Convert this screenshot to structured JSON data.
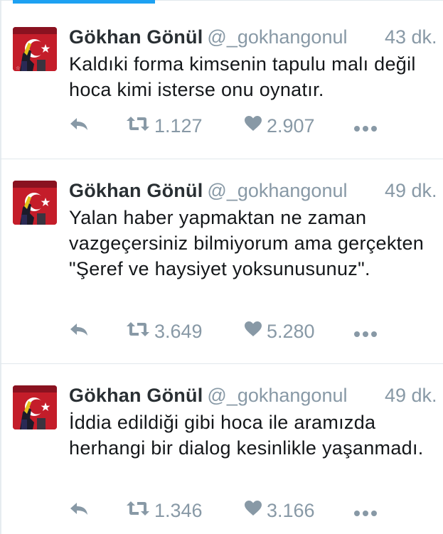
{
  "tweets": [
    {
      "name": "Gökhan Gönül",
      "handle": "@_gokhangonul",
      "time": "43 dk.",
      "text": "Kaldıki forma kimsenin tapulu malı değil hoca kimi isterse onu oynatır.",
      "retweets": "1.127",
      "likes": "2.907"
    },
    {
      "name": "Gökhan Gönül",
      "handle": "@_gokhangonul",
      "time": "49 dk.",
      "text": "Yalan haber yapmaktan ne zaman vazgeçersiniz bilmiyorum ama gerçekten \"Şeref ve haysiyet yoksunusunuz\".",
      "retweets": "3.649",
      "likes": "5.280"
    },
    {
      "name": "Gökhan Gönül",
      "handle": "@_gokhangonul",
      "time": "49 dk.",
      "text": "İddia edildiği gibi hoca ile aramızda herhangi bir dialog kesinlikle yaşanmadı.",
      "retweets": "1.346",
      "likes": "3.166"
    }
  ],
  "icons": {
    "reply": "reply-icon",
    "retweet": "retweet-icon",
    "like": "heart-icon",
    "more": "more-icon"
  },
  "colors": {
    "accent": "#1da1f2",
    "muted": "#8899a6",
    "text": "#14171a",
    "avatar_red": "#c41d2a"
  }
}
